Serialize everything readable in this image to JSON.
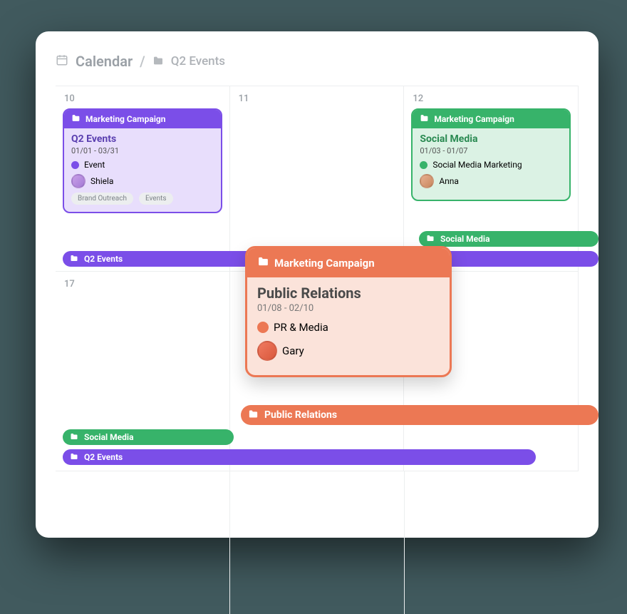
{
  "breadcrumb": {
    "root_label": "Calendar",
    "sub_label": "Q2 Events"
  },
  "days": {
    "d10": "10",
    "d11": "11",
    "d12": "12",
    "d17": "17"
  },
  "cards": {
    "q2events": {
      "folder": "Marketing Campaign",
      "title": "Q2 Events",
      "dates": "01/01 - 03/31",
      "category": "Event",
      "person": "Shiela",
      "tag1": "Brand Outreach",
      "tag2": "Events"
    },
    "socialmedia": {
      "folder": "Marketing Campaign",
      "title": "Social Media",
      "dates": "01/03 - 01/07",
      "category": "Social Media Marketing",
      "person": "Anna"
    },
    "publicrelations": {
      "folder": "Marketing Campaign",
      "title": "Public Relations",
      "dates": "01/08 - 02/10",
      "category": "PR & Media",
      "person": "Gary"
    }
  },
  "bars": {
    "q2events": "Q2 Events",
    "socialmedia": "Social Media",
    "publicrelations": "Public Relations"
  },
  "colors": {
    "purple": "#7b4ee8",
    "green": "#37b36a",
    "orange": "#ec7854"
  }
}
